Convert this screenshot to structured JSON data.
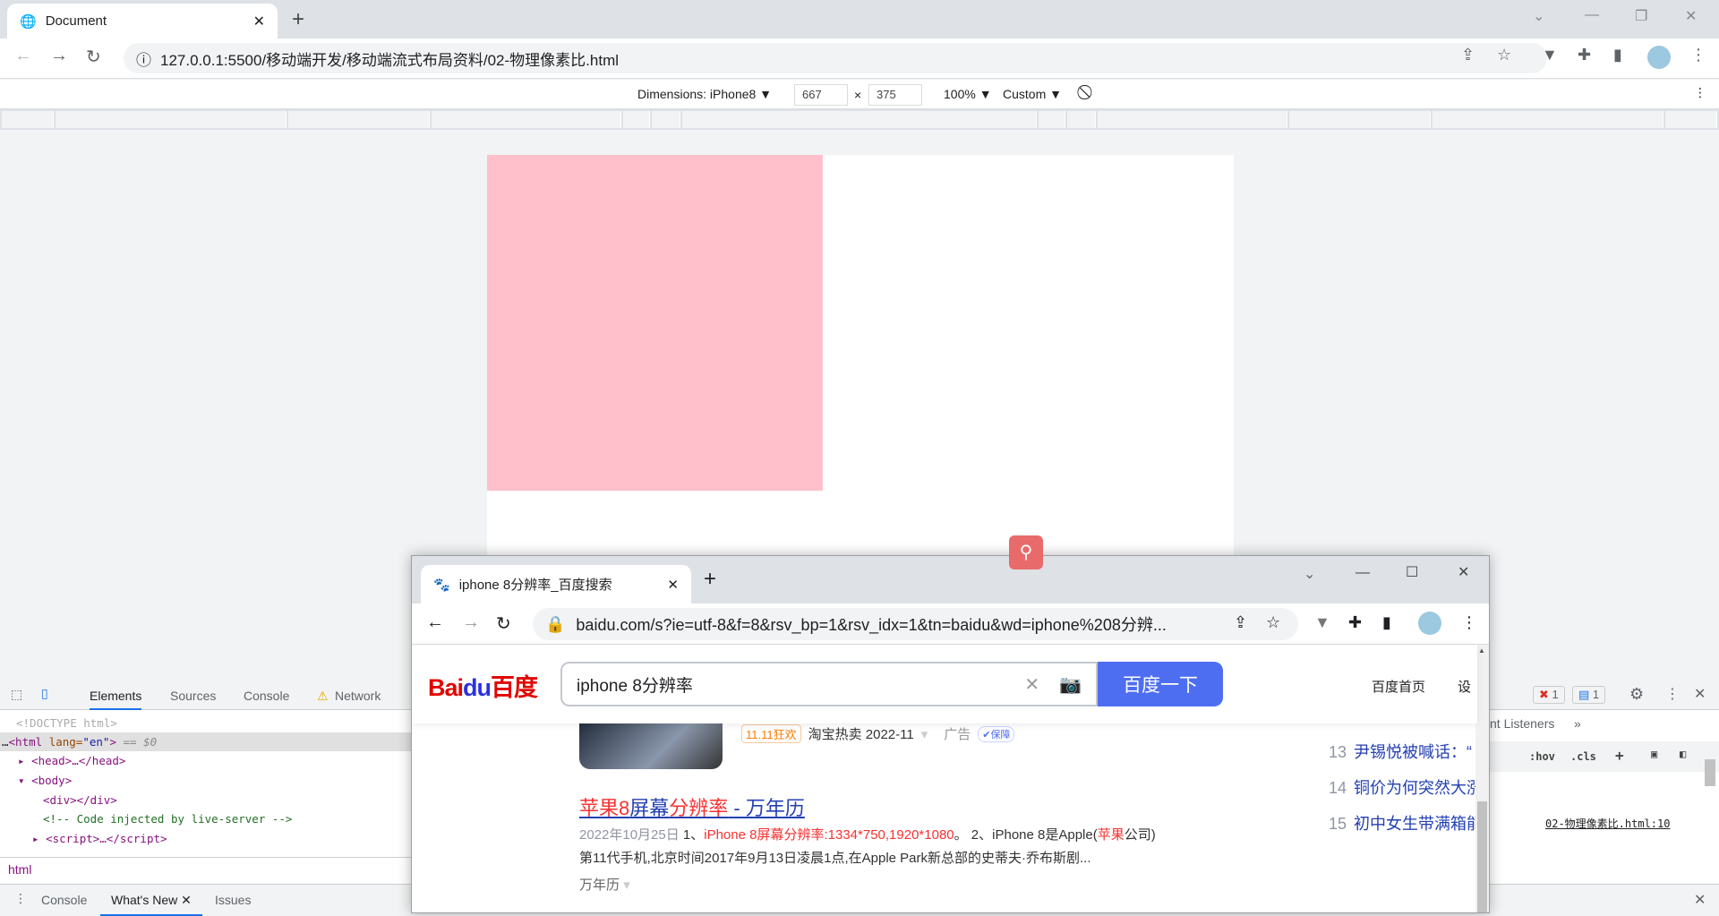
{
  "browser": {
    "tab_title": "Document",
    "url": "127.0.0.1:5500/移动端开发/移动端流式布局资料/02-物理像素比.html"
  },
  "device_toolbar": {
    "dimensions": "Dimensions: iPhone8 ▼",
    "width": "667",
    "times": "×",
    "height": "375",
    "zoom": "100% ▼",
    "throttle": "Custom ▼"
  },
  "devtools": {
    "tabs": [
      "Elements",
      "Sources",
      "Console",
      "Network"
    ],
    "dom": {
      "doctype": "<!DOCTYPE html>",
      "html_open": "<html",
      "lang_attr": " lang=",
      "lang_val": "\"en\"",
      "html_close": ">",
      "sel": " == $0",
      "head": "<head>…</head>",
      "body": "<body>",
      "div": "<div></div>",
      "comment": "<!-- Code injected by live-server -->",
      "script": "<script>…</script>"
    },
    "breadcrumb": "html",
    "drawer_tabs": [
      "Console",
      "What's New",
      "Issues"
    ],
    "errors": "1",
    "messages": "1",
    "styles_tab": "nt Listeners",
    "hov": ":hov",
    "cls": ".cls",
    "source_link": "02-物理像素比.html:10"
  },
  "popup": {
    "tab_title": "iphone 8分辨率_百度搜索",
    "url": "baidu.com/s?ie=utf-8&f=8&rsv_bp=1&rsv_idx=1&tn=baidu&wd=iphone%208分辨...",
    "logo": "Bai du 百度",
    "query": "iphone 8分辨率",
    "search_button": "百度一下",
    "nav_links": [
      "百度首页",
      "设"
    ],
    "ad": {
      "badge": "11.11狂欢",
      "source": "淘宝热卖 2022-11",
      "label": "广告",
      "guarantee": "保障"
    },
    "result": {
      "title_red1": "苹果8",
      "title_blue1": "屏幕",
      "title_red2": "分辨率",
      "title_blue2": " - 万年历",
      "date": "2022年10月25日",
      "p1": " 1、",
      "hl": "iPhone 8屏幕分辨率:1334*750,1920*1080",
      "p2": "。 2、iPhone 8是Apple(",
      "hl2": "苹果",
      "p3": "公司)",
      "line2": "第11代手机,北京时间2017年9月13日凌晨1点,在Apple Park新总部的史蒂夫·乔布斯剧...",
      "source": "万年历"
    },
    "hot": [
      {
        "n": "13",
        "t": "尹锡悦被喊话：“"
      },
      {
        "n": "14",
        "t": "铜价为何突然大涨"
      },
      {
        "n": "15",
        "t": "初中女生带满箱能"
      }
    ]
  }
}
